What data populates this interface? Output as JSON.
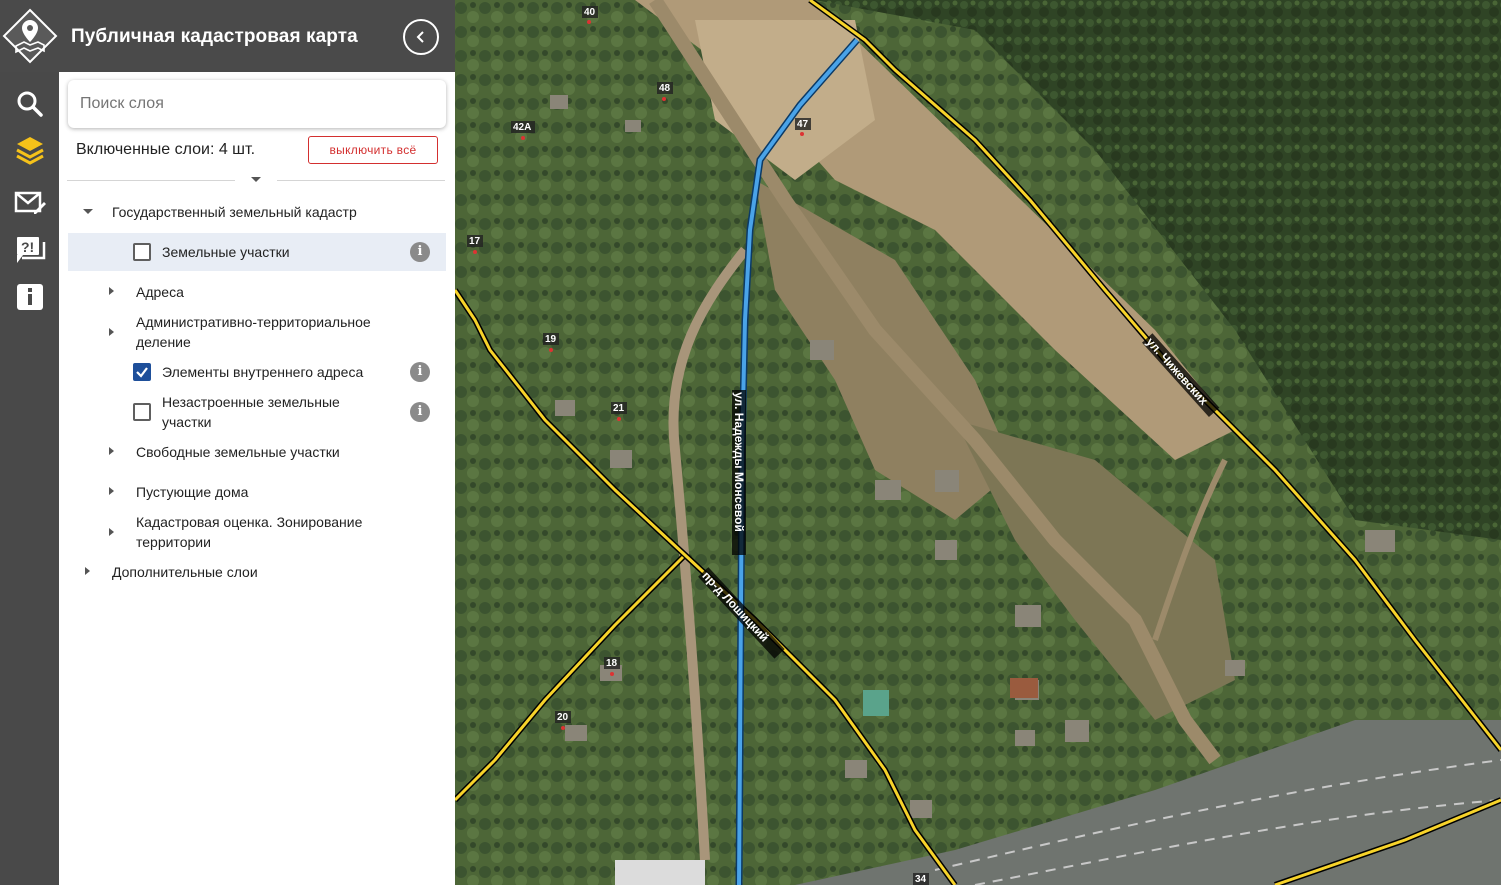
{
  "app": {
    "title": "Публичная кадастровая карта"
  },
  "rail": {
    "icons": [
      "logo-map-pin-icon",
      "search-icon",
      "layers-icon",
      "mail-edit-icon",
      "feedback-question-icon",
      "info-icon"
    ],
    "active_color": "#f6c21a"
  },
  "search": {
    "placeholder": "Поиск слоя"
  },
  "layers": {
    "enabled_text": "Включенные слои: 4 шт.",
    "disable_all_label": "выключить всё",
    "tree": {
      "group1": "Государственный земельный кадастр",
      "land_plots": "Земельные участки",
      "addresses": "Адреса",
      "admin_div": "Административно-территориальное деление",
      "inner_address": "Элементы внутреннего адреса",
      "undeveloped": "Незастроенные земельные участки",
      "free_plots": "Свободные земельные участки",
      "empty_houses": "Пустующие дома",
      "cadastral_eval": "Кадастровая оценка. Зонирование территории",
      "extra": "Дополнительные слои"
    },
    "checked": {
      "land_plots": false,
      "inner_address": true,
      "undeveloped": false
    }
  },
  "map": {
    "streets": {
      "nadezhdy": "ул. Надежды Монсевой",
      "chizhevskikh": "ул. Чижевских",
      "loshitsky": "пр-д Лошицкий"
    },
    "house_numbers": [
      "40",
      "48",
      "42А",
      "47",
      "17",
      "19",
      "21",
      "18",
      "20",
      "34"
    ],
    "colors": {
      "boundary": "#f7d32a",
      "street_line": "#4aa3e8"
    }
  }
}
